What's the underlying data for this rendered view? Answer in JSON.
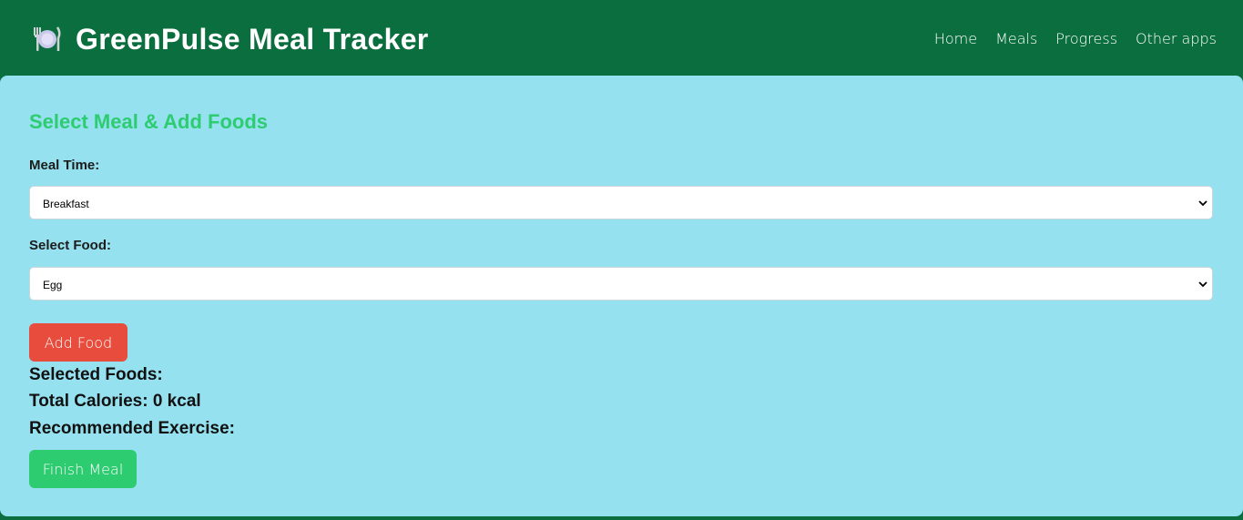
{
  "header": {
    "logo_icon": "plate-cutlery-icon",
    "title": "GreenPulse Meal Tracker",
    "nav": [
      {
        "label": "Home"
      },
      {
        "label": "Meals"
      },
      {
        "label": "Progress"
      },
      {
        "label": "Other apps"
      }
    ]
  },
  "main": {
    "section_title": "Select Meal & Add Foods",
    "meal_time": {
      "label": "Meal Time:",
      "selected": "Breakfast"
    },
    "food": {
      "label": "Select Food:",
      "selected": "Egg"
    },
    "add_food_label": "Add Food",
    "selected_foods_label": "Selected Foods:",
    "total_calories_text": "Total Calories: 0 kcal",
    "recommended_exercise_label": "Recommended Exercise:",
    "finish_meal_label": "Finish Meal"
  },
  "colors": {
    "header_bg": "#0b6e3f",
    "card_bg": "#95e1ef",
    "accent_green": "#2ecc71",
    "add_button": "#e74c3c"
  }
}
